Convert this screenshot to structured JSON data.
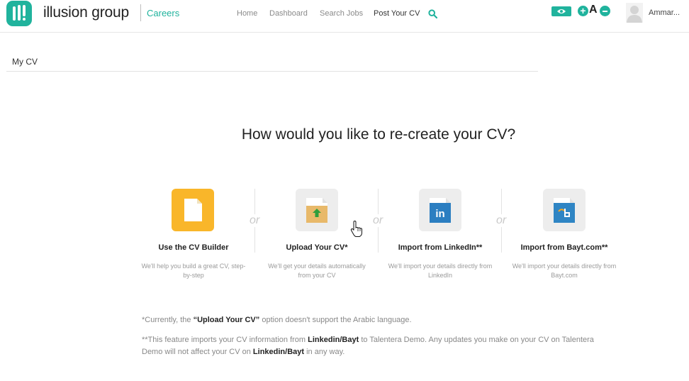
{
  "header": {
    "brand": "illusion group",
    "subbrand": "Careers",
    "nav": [
      "Home",
      "Dashboard",
      "Search Jobs",
      "Post Your CV"
    ],
    "zoom_letter": "A",
    "user_name": "Ammar..."
  },
  "page": {
    "title": "My CV",
    "question": "How would you like to re-create your CV?"
  },
  "options": [
    {
      "label": "Use the CV Builder",
      "desc": "We'll help you build a great CV, step-by-step",
      "icon": "cv-builder-icon"
    },
    {
      "label": "Upload Your CV*",
      "desc": "We'll get your details automatically from your CV",
      "icon": "upload-cv-icon"
    },
    {
      "label": "Import from LinkedIn**",
      "desc": "We'll import your details directly from LinkedIn",
      "icon": "linkedin-icon"
    },
    {
      "label": "Import from Bayt.com**",
      "desc": "We'll import your details directly from Bayt.com",
      "icon": "bayt-icon"
    }
  ],
  "or_text": "or",
  "notes": {
    "n1_pre": "*Currently, the ",
    "n1_bold": "“Upload Your CV”",
    "n1_post": " option doesn't support the Arabic language.",
    "n2_a": "**This feature imports your CV information from ",
    "n2_b": "Linkedin/Bayt",
    "n2_c": " to Talentera Demo. Any updates you make on your CV on Talentera Demo will not affect your CV on ",
    "n2_d": "Linkedin/Bayt",
    "n2_e": " in any way."
  },
  "colors": {
    "accent": "#20b39d",
    "builder": "#f9b62a",
    "upload": "#e8b96a",
    "linkedin": "#2b7ec1",
    "bayt": "#2f85c4"
  }
}
